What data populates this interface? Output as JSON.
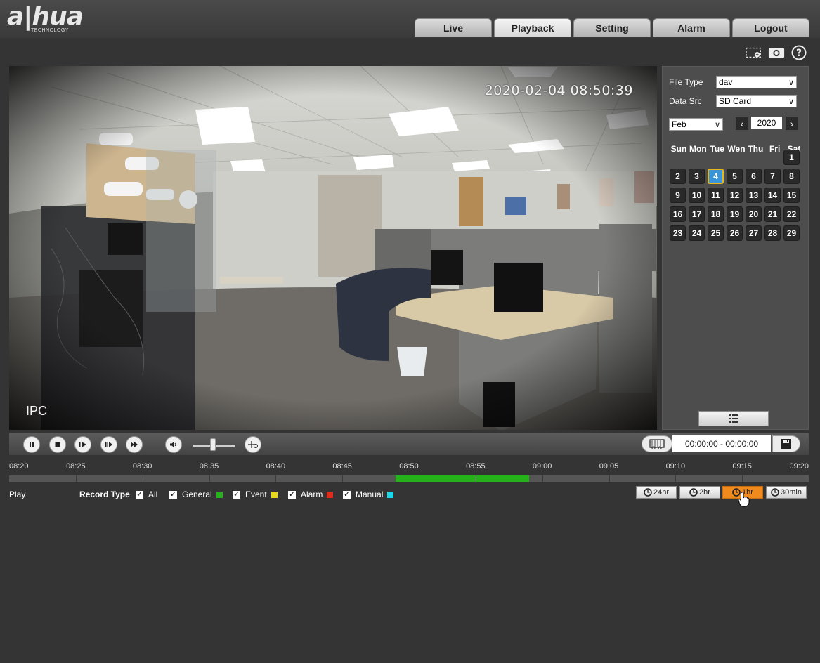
{
  "brand": {
    "logo": "a|hua",
    "sub": "TECHNOLOGY"
  },
  "nav": [
    {
      "label": "Live",
      "active": false
    },
    {
      "label": "Playback",
      "active": true
    },
    {
      "label": "Setting",
      "active": false
    },
    {
      "label": "Alarm",
      "active": false
    },
    {
      "label": "Logout",
      "active": false
    }
  ],
  "tools": {
    "icons": [
      "zoom-region-icon",
      "snapshot-icon",
      "help-icon"
    ]
  },
  "video": {
    "timestamp": "2020-02-04 08:50:39",
    "channel": "IPC"
  },
  "panel": {
    "file_type_label": "File Type",
    "file_type_value": "dav",
    "data_src_label": "Data Src",
    "data_src_value": "SD Card",
    "month": "Feb",
    "year": "2020",
    "weekdays": [
      "Sun",
      "Mon",
      "Tue",
      "Wen",
      "Thu",
      "Fri",
      "Sat"
    ],
    "days": [
      "1",
      "2",
      "3",
      "4",
      "5",
      "6",
      "7",
      "8",
      "9",
      "10",
      "11",
      "12",
      "13",
      "14",
      "15",
      "16",
      "17",
      "18",
      "19",
      "20",
      "21",
      "22",
      "23",
      "24",
      "25",
      "26",
      "27",
      "28",
      "29"
    ],
    "recorded_day": "4",
    "first_weekday": 6
  },
  "controls": {
    "time_range": "00:00:00 - 00:00:00"
  },
  "timeline": {
    "labels": [
      "08:20",
      "08:25",
      "08:30",
      "08:35",
      "08:40",
      "08:45",
      "08:50",
      "08:55",
      "09:00",
      "09:05",
      "09:10",
      "09:15",
      "09:20"
    ],
    "start_min": 500,
    "end_min": 560,
    "recording": {
      "from": "08:49",
      "to": "08:59",
      "color": "#25b11a"
    }
  },
  "bottom": {
    "play_label": "Play",
    "record_type_label": "Record Type",
    "checks": [
      {
        "label": "All",
        "color": ""
      },
      {
        "label": "General",
        "color": "#25b11a"
      },
      {
        "label": "Event",
        "color": "#e8d81a"
      },
      {
        "label": "Alarm",
        "color": "#e02a1a"
      },
      {
        "label": "Manual",
        "color": "#1ad8e8"
      }
    ],
    "zoom": [
      {
        "label": "24hr",
        "active": false
      },
      {
        "label": "2hr",
        "active": false
      },
      {
        "label": "1hr",
        "active": true
      },
      {
        "label": "30min",
        "active": false
      }
    ]
  }
}
